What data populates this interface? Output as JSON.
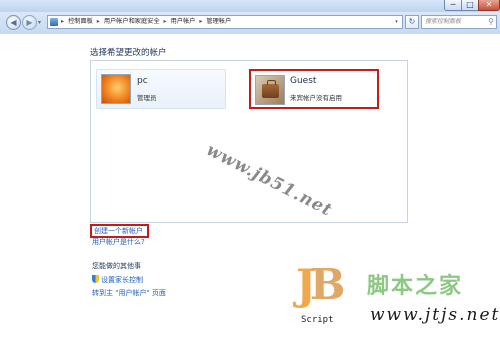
{
  "window": {
    "controls": {
      "minimize": "─",
      "maximize": "□",
      "close": "✕"
    }
  },
  "nav": {
    "back_icon": "◀",
    "forward_icon": "▶",
    "history_icon": "▾",
    "breadcrumbs": [
      "控制面板",
      "用户帐户和家庭安全",
      "用户帐户",
      "管理帐户"
    ],
    "separator": "▸",
    "refresh_icon": "↻",
    "search_placeholder": "搜索控制面板",
    "search_icon": "⚲"
  },
  "main": {
    "heading": "选择希望更改的帐户",
    "accounts": [
      {
        "name": "pc",
        "role": "管理员"
      },
      {
        "name": "Guest",
        "role": "来宾帐户没有启用"
      }
    ],
    "create_link": "创建一个新帐户",
    "what_link": "用户帐户是什么?",
    "also_title": "您能做的其他事",
    "also_items": [
      "设置家长控制",
      "转到主 \"用户帐户\" 页面"
    ]
  },
  "overlay": {
    "watermark": "www.jb51.net",
    "logo_j": "J",
    "logo_b": "B",
    "logo_sub": "Script",
    "logo_cn": "脚本之家",
    "logo_url": "www.jtjs.net"
  },
  "colors": {
    "accent_red": "#c51b1b",
    "link_blue": "#1f5fb8"
  }
}
